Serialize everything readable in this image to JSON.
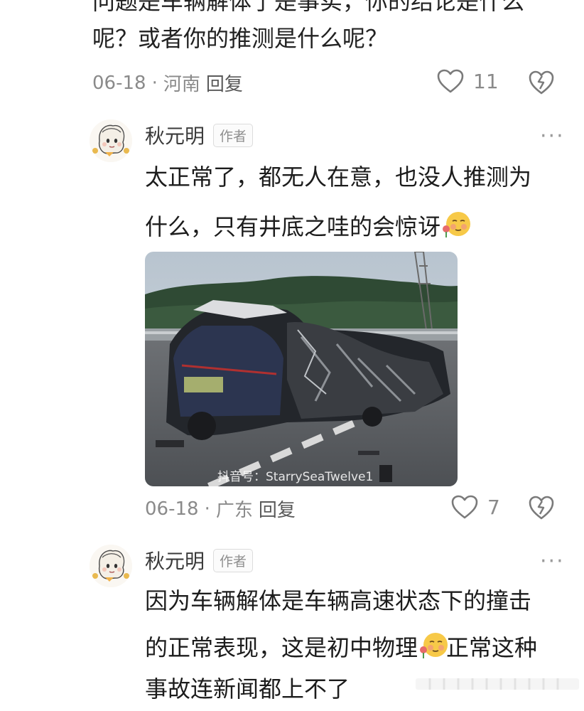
{
  "top_comment": {
    "line1": "问题是车辆解体了是事实，你的结论是什么",
    "line2": "呢？或者你的推测是什么呢？",
    "date": "06-18",
    "sep": "·",
    "location": "河南",
    "reply_label": "回复",
    "likes": "11"
  },
  "reply1": {
    "author": "秋元明",
    "tag": "作者",
    "more": "···",
    "line1": "太正常了，都无人在意，也没人推测为",
    "line2": "什么，只有井底之哇的会惊讶",
    "image_watermark": "抖音号：StarrySeaTwelve1",
    "date": "06-18",
    "sep": "·",
    "location": "广东",
    "reply_label": "回复",
    "likes": "7"
  },
  "reply2": {
    "author": "秋元明",
    "tag": "作者",
    "more": "···",
    "line1": "因为车辆解体是车辆高速状态下的撞击",
    "line2a": "的正常表现，这是初中物理",
    "line2b": "正常这种",
    "line3": "事故连新闻都上不了"
  },
  "colors": {
    "text": "#1c1c1c",
    "meta": "#8a8a8a",
    "icon": "#7a7a7a"
  },
  "icons": [
    "heart-icon",
    "dislike-heart-icon",
    "more-icon",
    "blush-emoji-icon",
    "avatar-cartoon"
  ]
}
